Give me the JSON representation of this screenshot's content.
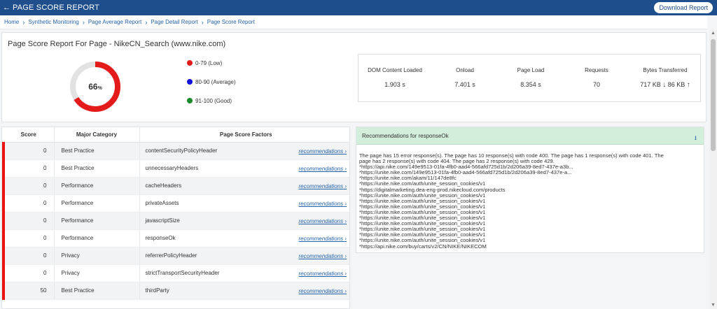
{
  "header": {
    "back_icon": "arrow-left-icon",
    "title": "PAGE SCORE REPORT",
    "download_label": "Download Report",
    "background_color": "#1f4e8c"
  },
  "breadcrumb": {
    "items": [
      "Home",
      "Synthetic Monitoring",
      "Page Average Report",
      "Page Detail Report",
      "Page Score Report"
    ],
    "separator_icon": "chevron-right-icon"
  },
  "summary": {
    "title": "Page Score Report For Page - NikeCN_Search (www.nike.com)",
    "score": {
      "value": 66,
      "value_label": "66",
      "unit_label": "%",
      "color": "#e31b1b"
    },
    "legend": [
      {
        "label": "0-79 (Low)",
        "color": "#e31b1b"
      },
      {
        "label": "80-90 (Average)",
        "color": "#1111dd"
      },
      {
        "label": "91-100 (Good)",
        "color": "#1b8a2a"
      }
    ],
    "metrics": [
      {
        "label": "DOM Content Loaded",
        "value": "1.903 s"
      },
      {
        "label": "Onload",
        "value": "7.401 s"
      },
      {
        "label": "Page Load",
        "value": "8.354 s"
      },
      {
        "label": "Requests",
        "value": "70"
      },
      {
        "label": "Bytes Transferred",
        "down_value": "717 KB",
        "down_icon": "arrow-down-icon",
        "up_value": "86 KB",
        "up_icon": "arrow-up-icon"
      }
    ]
  },
  "table": {
    "headers": {
      "score": "Score",
      "category": "Major Category",
      "factors": "Page Score Factors"
    },
    "link_label": "recommendations",
    "rows": [
      {
        "score": "0",
        "category": "Best Practice",
        "factor": "contentSecurityPolicyHeader"
      },
      {
        "score": "0",
        "category": "Best Practice",
        "factor": "unnecessaryHeaders"
      },
      {
        "score": "0",
        "category": "Performance",
        "factor": "cacheHeaders"
      },
      {
        "score": "0",
        "category": "Performance",
        "factor": "privateAssets"
      },
      {
        "score": "0",
        "category": "Performance",
        "factor": "javascriptSize"
      },
      {
        "score": "0",
        "category": "Performance",
        "factor": "responseOk"
      },
      {
        "score": "0",
        "category": "Privacy",
        "factor": "referrerPolicyHeader"
      },
      {
        "score": "0",
        "category": "Privacy",
        "factor": "strictTransportSecurityHeader"
      },
      {
        "score": "50",
        "category": "Best Practice",
        "factor": "thirdParty"
      }
    ],
    "row_marker_color": "#e11111"
  },
  "recommendations": {
    "title": "Recommendations for responseOk",
    "download_icon": "download-icon",
    "header_color": "#d3eedb",
    "lines": [
      "The page has 15 error response(s). The page has 10 response(s) with code 400. The page has 1 response(s) with code 401. The",
      "page has 2 response(s) with code 404. The page has 2 response(s) with code 429.",
      "*https://api.nike.com/149e9513-01fa-4fb0-aad4-566afd725d1b/2d206a39-8ed7-437e-a3b...",
      "*https://unite.nike.com/149e9513-01fa-4fb0-aad4-566afd725d1b/2d206a39-8ed7-437e-a...",
      "*https://unite.nike.com/akam/11/147de8fc",
      "*https://unite.nike.com/auth/unite_session_cookies/v1",
      "*https://digitalmarketing.dea-eng-prod.nikecloud.com/products",
      "*https://unite.nike.com/auth/unite_session_cookies/v1",
      "*https://unite.nike.com/auth/unite_session_cookies/v1",
      "*https://unite.nike.com/auth/unite_session_cookies/v1",
      "*https://unite.nike.com/auth/unite_session_cookies/v1",
      "*https://unite.nike.com/auth/unite_session_cookies/v1",
      "*https://unite.nike.com/auth/unite_session_cookies/v1",
      "*https://unite.nike.com/auth/unite_session_cookies/v1",
      "*https://unite.nike.com/auth/unite_session_cookies/v1",
      "*https://unite.nike.com/auth/unite_session_cookies/v1",
      "*https://api.nike.com/buy/carts/v2/CN/NIKE/NIKECOM"
    ]
  }
}
